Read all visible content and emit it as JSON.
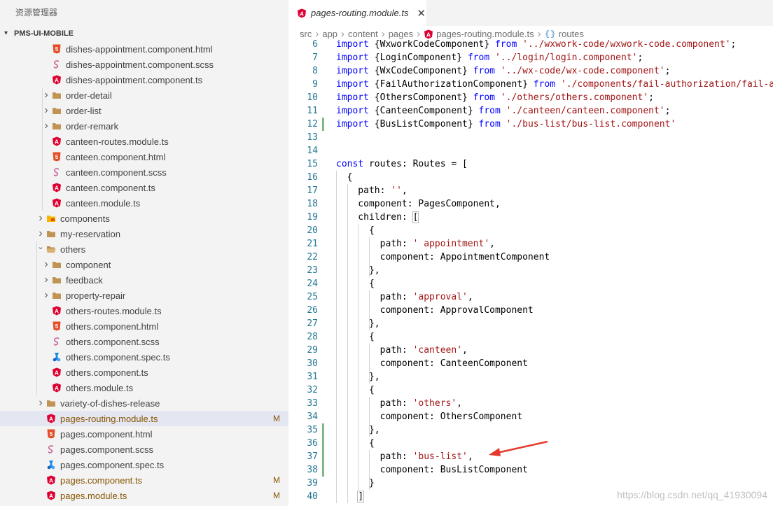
{
  "sidebar": {
    "title": "资源管理器",
    "section": "PMS-UI-MOBILE",
    "items": [
      {
        "label": "dishes-appointment.component.html",
        "icon": "html-icon",
        "indent": 3,
        "twisty": "none"
      },
      {
        "label": "dishes-appointment.component.scss",
        "icon": "scss-icon",
        "indent": 3,
        "twisty": "none"
      },
      {
        "label": "dishes-appointment.component.ts",
        "icon": "angular-icon",
        "indent": 3,
        "twisty": "none"
      },
      {
        "label": "order-detail",
        "icon": "folder-icon",
        "indent": 2,
        "twisty": "closed"
      },
      {
        "label": "order-list",
        "icon": "folder-icon",
        "indent": 2,
        "twisty": "closed"
      },
      {
        "label": "order-remark",
        "icon": "folder-icon",
        "indent": 2,
        "twisty": "closed"
      },
      {
        "label": "canteen-routes.module.ts",
        "icon": "angular-icon",
        "indent": 2,
        "twisty": "none"
      },
      {
        "label": "canteen.component.html",
        "icon": "html-icon",
        "indent": 2,
        "twisty": "none"
      },
      {
        "label": "canteen.component.scss",
        "icon": "scss-icon",
        "indent": 2,
        "twisty": "none"
      },
      {
        "label": "canteen.component.ts",
        "icon": "angular-icon",
        "indent": 2,
        "twisty": "none"
      },
      {
        "label": "canteen.module.ts",
        "icon": "angular-icon",
        "indent": 2,
        "twisty": "none"
      },
      {
        "label": "components",
        "icon": "components-folder-icon",
        "indent": 1,
        "twisty": "closed"
      },
      {
        "label": "my-reservation",
        "icon": "folder-icon",
        "indent": 1,
        "twisty": "closed"
      },
      {
        "label": "others",
        "icon": "folder-open-icon",
        "indent": 1,
        "twisty": "open"
      },
      {
        "label": "component",
        "icon": "folder-icon",
        "indent": 2,
        "twisty": "closed"
      },
      {
        "label": "feedback",
        "icon": "folder-icon",
        "indent": 2,
        "twisty": "closed"
      },
      {
        "label": "property-repair",
        "icon": "folder-icon",
        "indent": 2,
        "twisty": "closed"
      },
      {
        "label": "others-routes.module.ts",
        "icon": "angular-icon",
        "indent": 2,
        "twisty": "none"
      },
      {
        "label": "others.component.html",
        "icon": "html-icon",
        "indent": 2,
        "twisty": "none"
      },
      {
        "label": "others.component.scss",
        "icon": "scss-icon",
        "indent": 2,
        "twisty": "none"
      },
      {
        "label": "others.component.spec.ts",
        "icon": "spec-icon",
        "indent": 2,
        "twisty": "none"
      },
      {
        "label": "others.component.ts",
        "icon": "angular-icon",
        "indent": 2,
        "twisty": "none"
      },
      {
        "label": "others.module.ts",
        "icon": "angular-icon",
        "indent": 2,
        "twisty": "none"
      },
      {
        "label": "variety-of-dishes-release",
        "icon": "folder-icon",
        "indent": 1,
        "twisty": "closed"
      },
      {
        "label": "pages-routing.module.ts",
        "icon": "angular-icon",
        "indent": 1,
        "twisty": "none",
        "selected": true,
        "modified": true,
        "badge": "M"
      },
      {
        "label": "pages.component.html",
        "icon": "html-icon",
        "indent": 1,
        "twisty": "none"
      },
      {
        "label": "pages.component.scss",
        "icon": "scss-icon",
        "indent": 1,
        "twisty": "none"
      },
      {
        "label": "pages.component.spec.ts",
        "icon": "spec-icon",
        "indent": 1,
        "twisty": "none"
      },
      {
        "label": "pages.component.ts",
        "icon": "angular-icon",
        "indent": 1,
        "twisty": "none",
        "modified": true,
        "badge": "M"
      },
      {
        "label": "pages.module.ts",
        "icon": "angular-icon",
        "indent": 1,
        "twisty": "none",
        "modified": true,
        "badge": "M"
      },
      {
        "label": "...",
        "icon": "folder-icon",
        "indent": 0,
        "twisty": "open"
      }
    ]
  },
  "editor": {
    "tab": {
      "label": "pages-routing.module.ts",
      "close": "✕"
    },
    "breadcrumb": [
      "src",
      "app",
      "content",
      "pages",
      "pages-routing.module.ts",
      "routes"
    ],
    "lines": [
      {
        "n": "6",
        "tokens": [
          [
            "kw",
            "import"
          ],
          [
            "plain",
            " {WxworkCodeComponent} "
          ],
          [
            "kw",
            "from"
          ],
          [
            "plain",
            " "
          ],
          [
            "str",
            "'../wxwork-code/wxwork-code.component'"
          ],
          [
            "plain",
            ";"
          ]
        ]
      },
      {
        "n": "7",
        "tokens": [
          [
            "kw",
            "import"
          ],
          [
            "plain",
            " {LoginComponent} "
          ],
          [
            "kw",
            "from"
          ],
          [
            "plain",
            " "
          ],
          [
            "str",
            "'../login/login.component'"
          ],
          [
            "plain",
            ";"
          ]
        ]
      },
      {
        "n": "8",
        "tokens": [
          [
            "kw",
            "import"
          ],
          [
            "plain",
            " {WxCodeComponent} "
          ],
          [
            "kw",
            "from"
          ],
          [
            "plain",
            " "
          ],
          [
            "str",
            "'../wx-code/wx-code.component'"
          ],
          [
            "plain",
            ";"
          ]
        ]
      },
      {
        "n": "9",
        "tokens": [
          [
            "kw",
            "import"
          ],
          [
            "plain",
            " {FailAuthorizationComponent} "
          ],
          [
            "kw",
            "from"
          ],
          [
            "plain",
            " "
          ],
          [
            "str",
            "'./components/fail-authorization/fail-authorization.component'"
          ],
          [
            "plain",
            ";"
          ]
        ]
      },
      {
        "n": "10",
        "tokens": [
          [
            "kw",
            "import"
          ],
          [
            "plain",
            " {OthersComponent} "
          ],
          [
            "kw",
            "from"
          ],
          [
            "plain",
            " "
          ],
          [
            "str",
            "'./others/others.component'"
          ],
          [
            "plain",
            ";"
          ]
        ]
      },
      {
        "n": "11",
        "tokens": [
          [
            "kw",
            "import"
          ],
          [
            "plain",
            " {CanteenComponent} "
          ],
          [
            "kw",
            "from"
          ],
          [
            "plain",
            " "
          ],
          [
            "str",
            "'./canteen/canteen.component'"
          ],
          [
            "plain",
            ";"
          ]
        ]
      },
      {
        "n": "12",
        "tokens": [
          [
            "kw",
            "import"
          ],
          [
            "plain",
            " {BusListComponent} "
          ],
          [
            "kw",
            "from"
          ],
          [
            "plain",
            " "
          ],
          [
            "str",
            "'./bus-list/bus-list.component'"
          ]
        ],
        "mod": true
      },
      {
        "n": "13",
        "tokens": []
      },
      {
        "n": "14",
        "tokens": []
      },
      {
        "n": "15",
        "tokens": [
          [
            "kw",
            "const"
          ],
          [
            "plain",
            " routes: Routes = ["
          ]
        ]
      },
      {
        "n": "16",
        "tokens": [
          [
            "plain",
            "  {"
          ]
        ]
      },
      {
        "n": "17",
        "tokens": [
          [
            "plain",
            "    path: "
          ],
          [
            "str",
            "''"
          ],
          [
            "plain",
            ","
          ]
        ]
      },
      {
        "n": "18",
        "tokens": [
          [
            "plain",
            "    component: PagesComponent,"
          ]
        ]
      },
      {
        "n": "19",
        "tokens": [
          [
            "plain",
            "    children: "
          ],
          [
            "box",
            "["
          ]
        ]
      },
      {
        "n": "20",
        "tokens": [
          [
            "plain",
            "      {"
          ]
        ]
      },
      {
        "n": "21",
        "tokens": [
          [
            "plain",
            "        path: "
          ],
          [
            "str",
            "' appointment'"
          ],
          [
            "plain",
            ","
          ]
        ]
      },
      {
        "n": "22",
        "tokens": [
          [
            "plain",
            "        component: AppointmentComponent"
          ]
        ]
      },
      {
        "n": "23",
        "tokens": [
          [
            "plain",
            "      },"
          ]
        ]
      },
      {
        "n": "24",
        "tokens": [
          [
            "plain",
            "      {"
          ]
        ]
      },
      {
        "n": "25",
        "tokens": [
          [
            "plain",
            "        path: "
          ],
          [
            "str",
            "'approval'"
          ],
          [
            "plain",
            ","
          ]
        ]
      },
      {
        "n": "26",
        "tokens": [
          [
            "plain",
            "        component: ApprovalComponent"
          ]
        ]
      },
      {
        "n": "27",
        "tokens": [
          [
            "plain",
            "      },"
          ]
        ]
      },
      {
        "n": "28",
        "tokens": [
          [
            "plain",
            "      {"
          ]
        ]
      },
      {
        "n": "29",
        "tokens": [
          [
            "plain",
            "        path: "
          ],
          [
            "str",
            "'canteen'"
          ],
          [
            "plain",
            ","
          ]
        ]
      },
      {
        "n": "30",
        "tokens": [
          [
            "plain",
            "        component: CanteenComponent"
          ]
        ]
      },
      {
        "n": "31",
        "tokens": [
          [
            "plain",
            "      },"
          ]
        ]
      },
      {
        "n": "32",
        "tokens": [
          [
            "plain",
            "      {"
          ]
        ]
      },
      {
        "n": "33",
        "tokens": [
          [
            "plain",
            "        path: "
          ],
          [
            "str",
            "'others'"
          ],
          [
            "plain",
            ","
          ]
        ]
      },
      {
        "n": "34",
        "tokens": [
          [
            "plain",
            "        component: OthersComponent"
          ]
        ]
      },
      {
        "n": "35",
        "tokens": [
          [
            "plain",
            "      },"
          ]
        ],
        "mod": true
      },
      {
        "n": "36",
        "tokens": [
          [
            "plain",
            "      {"
          ]
        ],
        "mod": true
      },
      {
        "n": "37",
        "tokens": [
          [
            "plain",
            "        path: "
          ],
          [
            "str",
            "'bus-list'"
          ],
          [
            "plain",
            ","
          ]
        ],
        "mod": true
      },
      {
        "n": "38",
        "tokens": [
          [
            "plain",
            "        component: BusListComponent"
          ]
        ],
        "mod": true
      },
      {
        "n": "39",
        "tokens": [
          [
            "plain",
            "      }"
          ]
        ]
      },
      {
        "n": "40",
        "tokens": [
          [
            "plain",
            "    "
          ],
          [
            "box",
            "]"
          ]
        ]
      }
    ]
  },
  "watermark": "https://blog.csdn.net/qq_41930094",
  "colors": {
    "angular": "#dd0031",
    "html": "#e44d26",
    "scss": "#cd6799",
    "folder": "#c09553",
    "spec": "#1e88e5",
    "components_folder": "#f4b400"
  }
}
